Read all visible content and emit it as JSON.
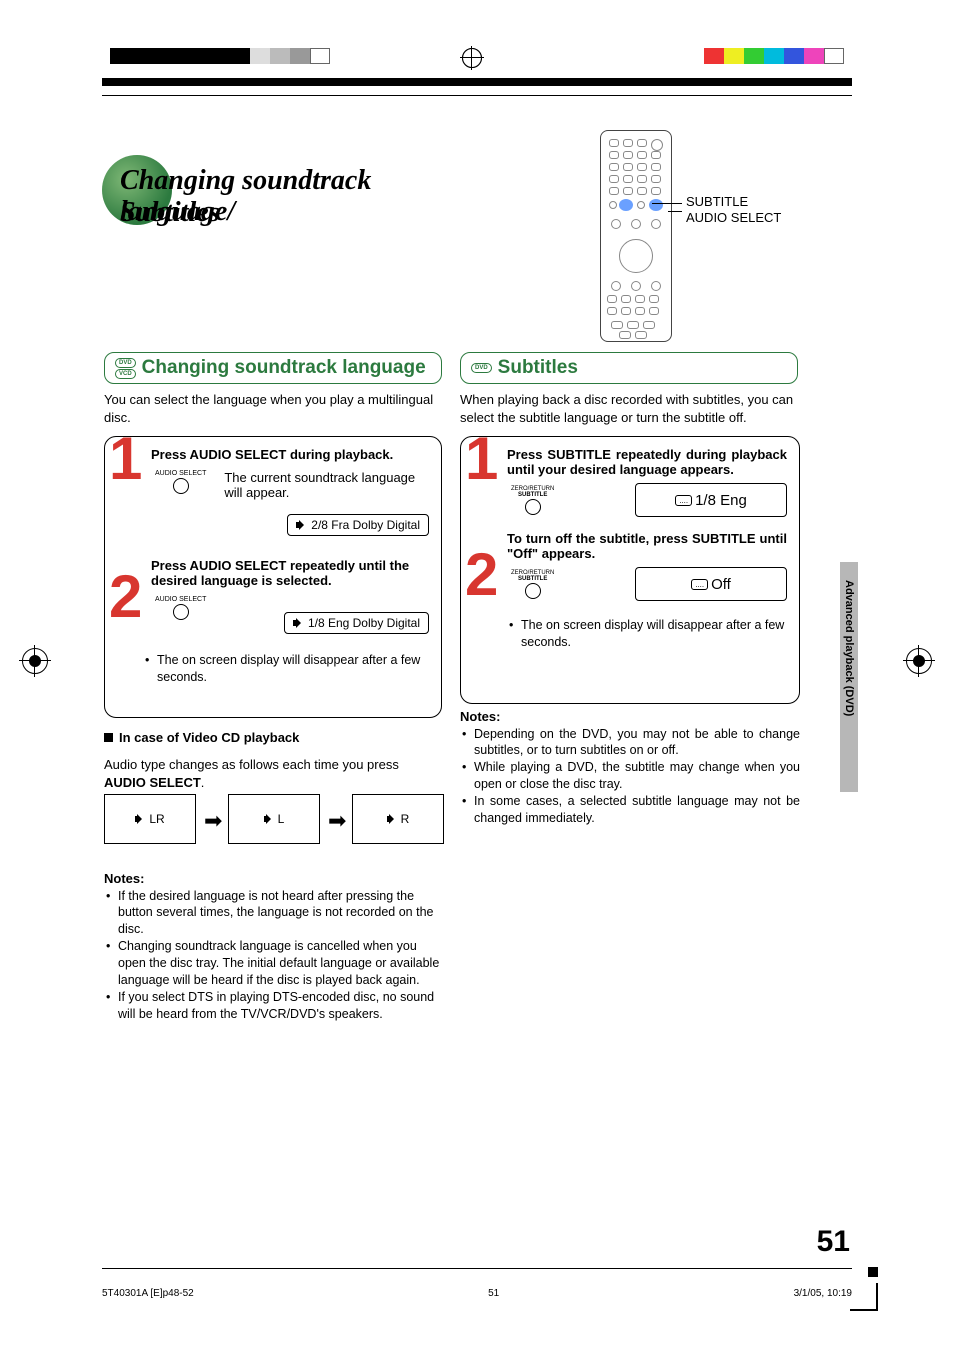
{
  "page_title_line1": "Changing soundtrack language/",
  "page_title_line2": "Subtitles",
  "remote_callout1": "SUBTITLE",
  "remote_callout2": "AUDIO SELECT",
  "left": {
    "heading": "Changing soundtrack language",
    "disc_badges": [
      "DVD",
      "VCD"
    ],
    "intro": "You can select the language when you play a multilingual disc.",
    "step1_bold": "Press AUDIO SELECT during playback.",
    "step1_btn_label": "AUDIO SELECT",
    "step1_desc": "The current soundtrack language will appear.",
    "step1_osd": "2/8 Fra Dolby Digital",
    "step2_bold": "Press AUDIO SELECT repeatedly until the desired language is selected.",
    "step2_btn_label": "AUDIO SELECT",
    "step2_osd": "1/8 Eng Dolby Digital",
    "step2_note": "The on screen display will disappear after a few seconds.",
    "vcd_head": "In case of Video CD playback",
    "vcd_desc1": "Audio type changes as follows each time you press ",
    "vcd_desc2": "AUDIO SELECT",
    "vcd_desc3": ".",
    "cycle": [
      "LR",
      "L",
      "R"
    ],
    "notes_head": "Notes:",
    "notes": [
      "If the desired language is not heard after pressing the button several times, the language is not recorded on the disc.",
      "Changing soundtrack language is cancelled when you open the disc tray. The initial default language or available language will be heard if the disc is played back again.",
      "If you select DTS in playing DTS-encoded disc, no sound will be heard from the TV/VCR/DVD's speakers."
    ]
  },
  "right": {
    "heading": "Subtitles",
    "disc_badges": [
      "DVD"
    ],
    "intro": "When playing back a disc recorded with subtitles, you can select the subtitle language or turn the subtitle off.",
    "step1_bold": "Press SUBTITLE repeatedly during playback until your desired language appears.",
    "step1_btn_label1": "ZERO/RETURN",
    "step1_btn_label2": "SUBTITLE",
    "step1_osd": "1/8 Eng",
    "step2_bold": "To turn off the subtitle, press SUBTITLE until \"Off\" appears.",
    "step2_btn_label1": "ZERO/RETURN",
    "step2_btn_label2": "SUBTITLE",
    "step2_osd": "Off",
    "step2_note": "The on screen display will disappear after a few seconds.",
    "notes_head": "Notes:",
    "notes": [
      "Depending on the DVD, you may not be able to change subtitles, or to turn subtitles on or off.",
      "While playing a DVD, the subtitle may change when you open or close the disc tray.",
      "In some cases, a selected subtitle language may not be changed immediately."
    ]
  },
  "side_tab": "Advanced playback (DVD)",
  "page_number": "51",
  "footer_left": "5T40301A [E]p48-52",
  "footer_center": "51",
  "footer_right": "3/1/05, 10:19"
}
